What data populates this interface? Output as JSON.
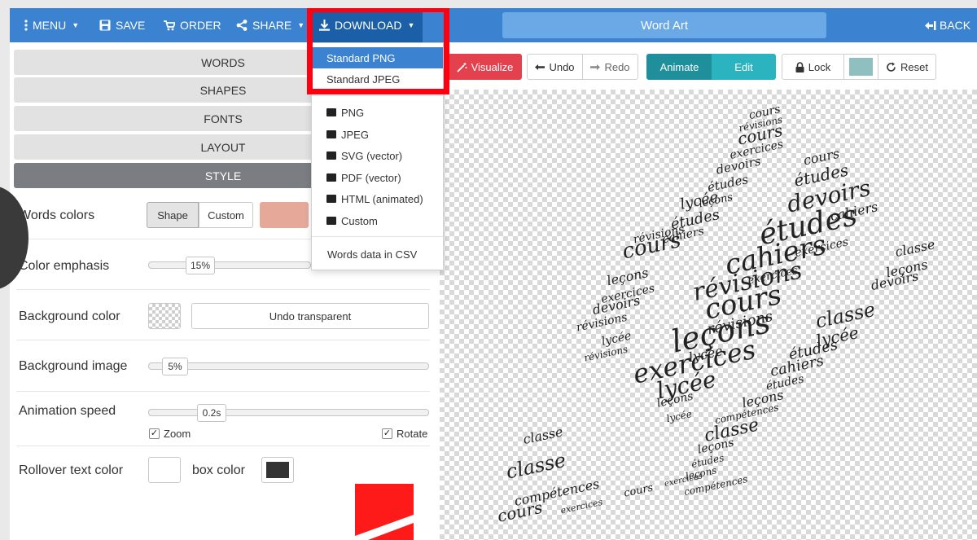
{
  "nav": {
    "menu": "MENU",
    "save": "SAVE",
    "order": "ORDER",
    "share": "SHARE",
    "download": "DOWNLOAD",
    "title": "Word Art",
    "back": "BACK"
  },
  "download_menu": {
    "items": [
      "Standard PNG",
      "Standard JPEG",
      "PNG",
      "JPEG",
      "SVG (vector)",
      "PDF (vector)",
      "HTML (animated)",
      "Custom",
      "Words data in CSV"
    ],
    "selected": "Standard PNG",
    "format_icon": "hd-badge-icon"
  },
  "sidebar": {
    "sections": [
      "WORDS",
      "SHAPES",
      "FONTS",
      "LAYOUT",
      "STYLE"
    ],
    "active_section": "STYLE"
  },
  "style_panel": {
    "words_colors": {
      "label": "Words colors",
      "options": [
        "Shape",
        "Custom"
      ],
      "selected": "Shape"
    },
    "color_emphasis": {
      "label": "Color emphasis",
      "value": "15%",
      "fraction": 0.15
    },
    "background_color": {
      "label": "Background color",
      "button": "Undo transparent"
    },
    "background_image": {
      "label": "Background image",
      "value": "5%",
      "fraction": 0.05
    },
    "animation_speed": {
      "label": "Animation speed",
      "value": "0.2s",
      "zoom_label": "Zoom",
      "rotate_label": "Rotate",
      "zoom_checked": true,
      "rotate_checked": true
    },
    "rollover": {
      "label": "Rollover text color",
      "box_label": "box color"
    }
  },
  "toolbar": {
    "visualize": "Visualize",
    "undo": "Undo",
    "redo": "Redo",
    "animate": "Animate",
    "edit": "Edit",
    "lock": "Lock",
    "reset": "Reset"
  },
  "canvas_words": [
    "cours",
    "révisions",
    "exercices",
    "devoirs",
    "études",
    "cahiers",
    "leçons",
    "lycée",
    "classe",
    "compétences"
  ],
  "colors": {
    "nav_bg": "#3b83d0",
    "highlight": "#ff0010",
    "visualize_bg": "#e4414e",
    "animate_bg": "#1f8f9c",
    "edit_bg": "#2bb3c0",
    "accent_swatch": "#e6a899",
    "lock_swatch": "#8fbfbf",
    "box_color": "#333333"
  }
}
